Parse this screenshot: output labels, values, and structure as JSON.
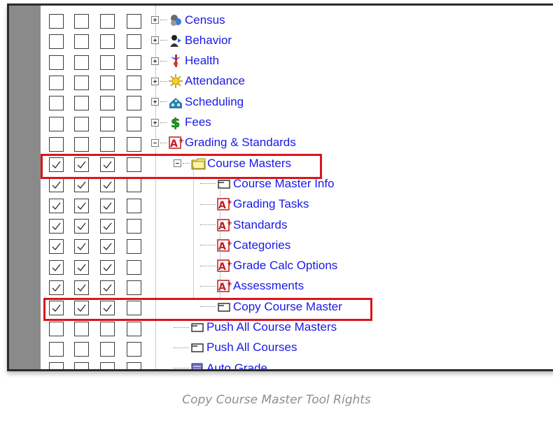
{
  "tree": {
    "rows": [
      {
        "label": "Census",
        "icon": "census-icon",
        "checks": [
          false,
          false,
          false,
          false
        ],
        "expander": "plus",
        "level": 0
      },
      {
        "label": "Behavior",
        "icon": "behavior-icon",
        "checks": [
          false,
          false,
          false,
          false
        ],
        "expander": "plus",
        "level": 0
      },
      {
        "label": "Health",
        "icon": "health-icon",
        "checks": [
          false,
          false,
          false,
          false
        ],
        "expander": "plus",
        "level": 0
      },
      {
        "label": "Attendance",
        "icon": "attendance-icon",
        "checks": [
          false,
          false,
          false,
          false
        ],
        "expander": "plus",
        "level": 0
      },
      {
        "label": "Scheduling",
        "icon": "scheduling-icon",
        "checks": [
          false,
          false,
          false,
          false
        ],
        "expander": "plus",
        "level": 0
      },
      {
        "label": "Fees",
        "icon": "fees-icon",
        "checks": [
          false,
          false,
          false,
          false
        ],
        "expander": "plus",
        "level": 0
      },
      {
        "label": "Grading & Standards",
        "icon": "grading-icon",
        "checks": [
          false,
          false,
          false,
          false
        ],
        "expander": "minus",
        "level": 0
      },
      {
        "label": "Course Masters",
        "icon": "folder-icon",
        "checks": [
          true,
          true,
          true,
          false
        ],
        "expander": "minus",
        "level": 1
      },
      {
        "label": "Course Master Info",
        "icon": "page-icon",
        "checks": [
          true,
          true,
          true,
          false
        ],
        "expander": "none",
        "level": 2
      },
      {
        "label": "Grading Tasks",
        "icon": "grading-icon",
        "checks": [
          true,
          true,
          true,
          false
        ],
        "expander": "none",
        "level": 2
      },
      {
        "label": "Standards",
        "icon": "grading-icon",
        "checks": [
          true,
          true,
          true,
          false
        ],
        "expander": "none",
        "level": 2
      },
      {
        "label": "Categories",
        "icon": "grading-icon",
        "checks": [
          true,
          true,
          true,
          false
        ],
        "expander": "none",
        "level": 2
      },
      {
        "label": "Grade Calc Options",
        "icon": "grading-icon",
        "checks": [
          true,
          true,
          true,
          false
        ],
        "expander": "none",
        "level": 2
      },
      {
        "label": "Assessments",
        "icon": "grading-icon",
        "checks": [
          true,
          true,
          true,
          false
        ],
        "expander": "none",
        "level": 2
      },
      {
        "label": "Copy Course Master",
        "icon": "page-icon",
        "checks": [
          true,
          true,
          true,
          false
        ],
        "expander": "none",
        "level": 2
      },
      {
        "label": "Push All Course Masters",
        "icon": "page-icon",
        "checks": [
          false,
          false,
          false,
          false
        ],
        "expander": "none",
        "level": 1
      },
      {
        "label": "Push All Courses",
        "icon": "page-icon",
        "checks": [
          false,
          false,
          false,
          false
        ],
        "expander": "none",
        "level": 1
      },
      {
        "label": "Auto Grade",
        "icon": "autograde-icon",
        "checks": [
          false,
          false,
          false,
          false
        ],
        "expander": "none",
        "level": 1
      }
    ]
  },
  "caption": "Copy Course Master Tool Rights",
  "colors": {
    "link": "#1a1ae6",
    "highlight": "#d9161c",
    "gutter": "#8a8a8a"
  }
}
